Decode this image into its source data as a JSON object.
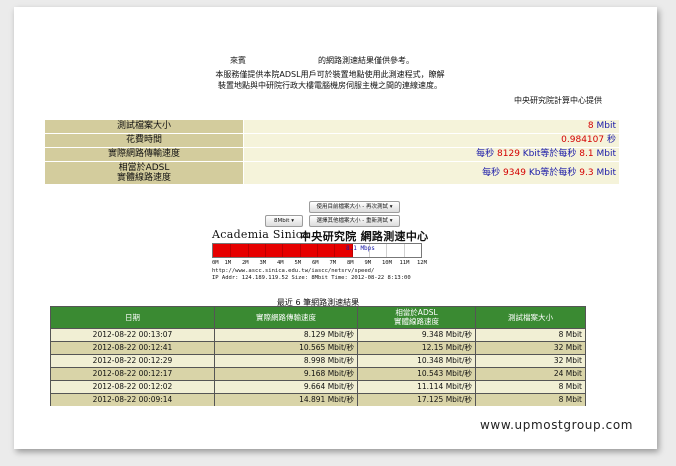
{
  "intro": {
    "guest_label": "來賓",
    "line1": "的網路測速結果僅供參考。",
    "line2": "本服務僅提供本院ADSL用戶可於裝置地點使用此測速程式，瞭解",
    "line3": "裝置地點與中研院行政大樓電腦機房伺服主機之間的連線速度。",
    "provider": "中央研究院計算中心提供"
  },
  "results": [
    {
      "label": "測試檔案大小",
      "parts": [
        {
          "t": "8",
          "c": "red"
        },
        {
          "t": " Mbit",
          "c": "blue"
        }
      ]
    },
    {
      "label": "花費時間",
      "parts": [
        {
          "t": "0.984107",
          "c": "red"
        },
        {
          "t": " 秒",
          "c": "blue"
        }
      ]
    },
    {
      "label": "實際網路傳輸速度",
      "parts": [
        {
          "t": "每秒 ",
          "c": "blue"
        },
        {
          "t": "8129",
          "c": "red"
        },
        {
          "t": " Kbit等於每秒 ",
          "c": "blue"
        },
        {
          "t": "8.1",
          "c": "red"
        },
        {
          "t": " Mbit",
          "c": "blue"
        }
      ]
    },
    {
      "label1": "相當於ADSL",
      "label2": "實體線路速度",
      "parts": [
        {
          "t": "每秒 ",
          "c": "blue"
        },
        {
          "t": "9349",
          "c": "red"
        },
        {
          "t": " Kb等於每秒 ",
          "c": "blue"
        },
        {
          "t": "9.3",
          "c": "red"
        },
        {
          "t": " Mbit",
          "c": "blue"
        }
      ]
    }
  ],
  "controls": {
    "retest_same": "使用目前檔案大小 - 再次測試 ▾",
    "size_select": "8Mbit ▾",
    "retest_other": "選擇其他檔案大小 - 重新測試 ▾"
  },
  "meter": {
    "brand_en": "Academia Sinica",
    "brand_zh": "中央研究院 網路測速中心",
    "fill_mbit": 8.1,
    "max_mbit": 12,
    "speed_label": "8.1 Mbps",
    "scale_ticks": [
      "0M",
      "1M",
      "2M",
      "3M",
      "4M",
      "5M",
      "6M",
      "7M",
      "8M",
      "9M",
      "10M",
      "11M",
      "12M"
    ],
    "url": "http://www.ascc.sinica.edu.tw/iascc/netsrv/speed/",
    "ip_line": "IP Addr: 124.189.119.52 Size: 8Mbit Time: 2012-08-22 8:13:00",
    "bar_color": "#e60000"
  },
  "history": {
    "title": "最近 6 筆網路測速結果",
    "headers": [
      "日期",
      "實際網路傳輸速度",
      "相當於ADSL\n實體線路速度",
      "測試檔案大小"
    ],
    "rows": [
      [
        "2012-08-22 00:13:07",
        "8.129 Mbit/秒",
        "9.348 Mbit/秒",
        "8 Mbit"
      ],
      [
        "2012-08-22 00:12:41",
        "10.565 Mbit/秒",
        "12.15 Mbit/秒",
        "32 Mbit"
      ],
      [
        "2012-08-22 00:12:29",
        "8.998 Mbit/秒",
        "10.348 Mbit/秒",
        "32 Mbit"
      ],
      [
        "2012-08-22 00:12:17",
        "9.168 Mbit/秒",
        "10.543 Mbit/秒",
        "24 Mbit"
      ],
      [
        "2012-08-22 00:12:02",
        "9.664 Mbit/秒",
        "11.114 Mbit/秒",
        "8 Mbit"
      ],
      [
        "2012-08-22 00:09:14",
        "14.891 Mbit/秒",
        "17.125 Mbit/秒",
        "8 Mbit"
      ]
    ]
  },
  "watermark": "www.upmostgroup.com"
}
